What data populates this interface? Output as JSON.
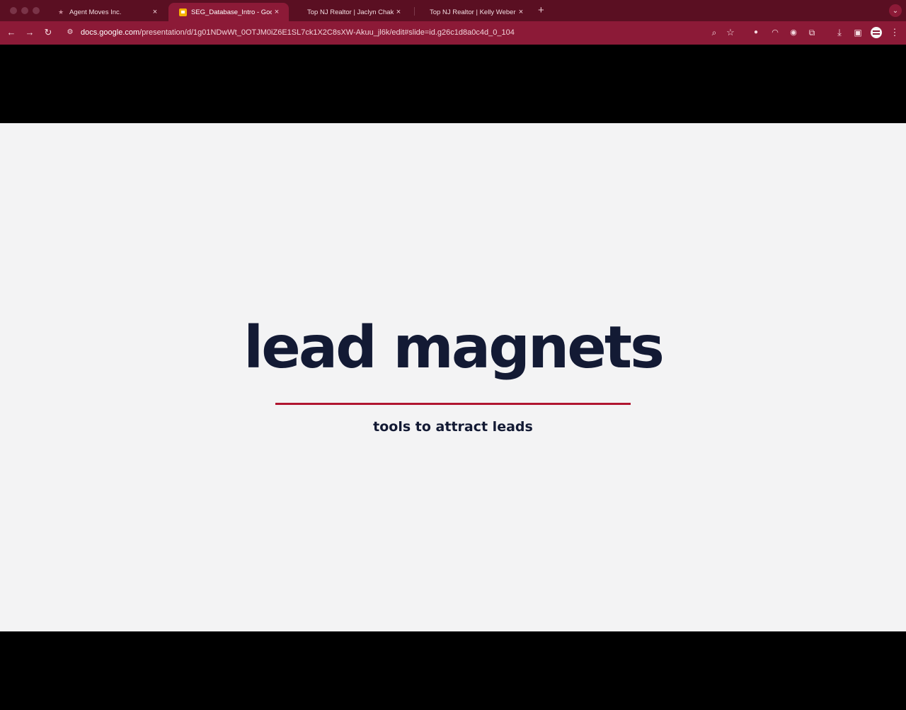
{
  "browser": {
    "tabs": [
      {
        "label": "Agent Moves Inc.",
        "active": false
      },
      {
        "label": "SEG_Database_Intro - Google Slides",
        "active": true
      },
      {
        "label": "Top NJ Realtor | Jaclyn Chakiris",
        "active": false
      },
      {
        "label": "Top NJ Realtor | Kelly Weber",
        "active": false
      }
    ],
    "close_glyph": "×",
    "new_tab_glyph": "+",
    "url_domain": "docs.google.com",
    "url_path": "/presentation/d/1g01NDwWt_0OTJM0iZ6E1SL7ck1X2C8sXW-Akuu_jl6k/edit#slide=id.g26c1d8a0c4d_0_104"
  },
  "slide": {
    "title": "lead magnets",
    "subtitle": "tools to attract leads"
  },
  "colors": {
    "tabstrip": "#5a0f22",
    "toolbar": "#8c1a37",
    "slide_bg": "#f3f3f4",
    "title_text": "#131a34",
    "accent_rule": "#b0152f"
  }
}
